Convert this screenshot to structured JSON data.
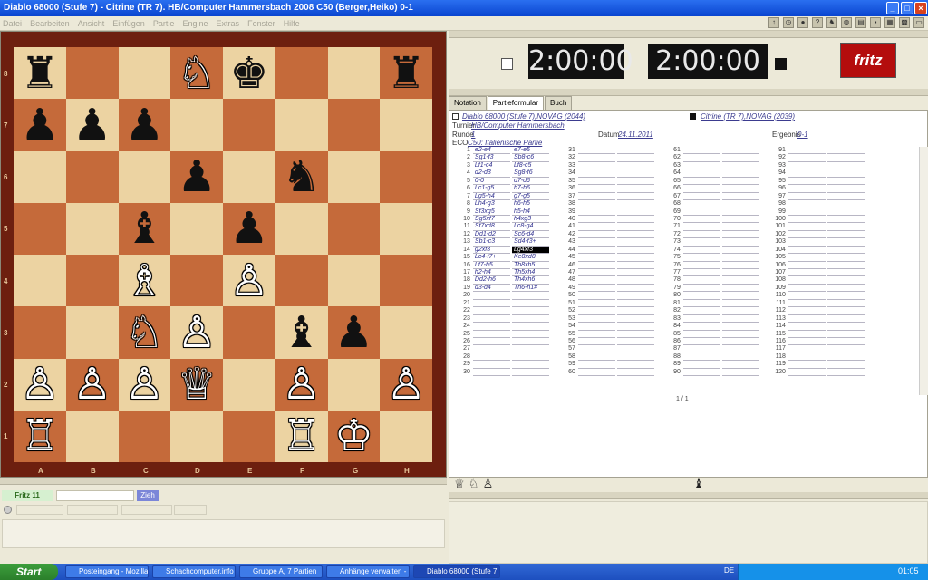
{
  "window": {
    "title": "Diablo 68000 (Stufe 7) - Citrine (TR 7). HB/Computer Hammersbach 2008  C50  (Berger,Heiko)  0-1"
  },
  "menu": [
    "Datei",
    "Bearbeiten",
    "Ansicht",
    "Einfügen",
    "Partie",
    "Engine",
    "Extras",
    "Fenster",
    "Hilfe"
  ],
  "board": {
    "files": [
      "A",
      "B",
      "C",
      "D",
      "E",
      "F",
      "G",
      "H"
    ],
    "ranks": [
      "8",
      "7",
      "6",
      "5",
      "4",
      "3",
      "2",
      "1"
    ],
    "position": [
      [
        "bR",
        "",
        "",
        "wN",
        "bK",
        "",
        "",
        "bR"
      ],
      [
        "bP",
        "bP",
        "bP",
        "",
        "",
        "",
        "",
        ""
      ],
      [
        "",
        "",
        "",
        "bP",
        "",
        "bN",
        "",
        ""
      ],
      [
        "",
        "",
        "bB",
        "",
        "bP",
        "",
        "",
        ""
      ],
      [
        "",
        "",
        "wB",
        "",
        "wP",
        "",
        "",
        ""
      ],
      [
        "",
        "",
        "wN",
        "wP",
        "",
        "bB",
        "bP",
        ""
      ],
      [
        "wP",
        "wP",
        "wP",
        "wQ",
        "",
        "wP",
        "",
        "wP"
      ],
      [
        "wR",
        "",
        "",
        "",
        "",
        "wR",
        "wK",
        ""
      ]
    ],
    "glyphs": {
      "wK": "♔",
      "wQ": "♕",
      "wR": "♖",
      "wB": "♗",
      "wN": "♘",
      "wP": "♙",
      "bK": "♚",
      "bQ": "♛",
      "bR": "♜",
      "bB": "♝",
      "bN": "♞",
      "bP": "♟"
    }
  },
  "clocks": {
    "white": "2:00:00",
    "black": "2:00:00"
  },
  "logo": "fritz",
  "tabs": [
    "Notation",
    "Partieformular",
    "Buch"
  ],
  "game": {
    "white": "Diablo 68000 (Stufe 7),NOVAG (2044)",
    "black": "Citrine (TR 7),NOVAG (2039)",
    "turnier_label": "Turnier",
    "turnier": "HB/Computer Hammersbach",
    "runde_label": "Runde",
    "runde": "1",
    "datum_label": "Datum",
    "datum": "24.11.2011",
    "ergebnis_label": "Ergebnis",
    "ergebnis": "0-1",
    "eco_label": "ECO",
    "eco": "C50: Italienische Partie"
  },
  "moves": [
    [
      "e2-e4",
      "e7-e5"
    ],
    [
      "Sg1-f3",
      "Sb8-c6"
    ],
    [
      "Lf1-c4",
      "Lf8-c5"
    ],
    [
      "d2-d3",
      "Sg8-f6"
    ],
    [
      "0-0",
      "d7-d6"
    ],
    [
      "Lc1-g5",
      "h7-h6"
    ],
    [
      "Lg5-h4",
      "g7-g5"
    ],
    [
      "Lh4-g3",
      "h6-h5"
    ],
    [
      "Sf3xg5",
      "h5-h4"
    ],
    [
      "Sg5xf7",
      "h4xg3"
    ],
    [
      "Sf7xd8",
      "Lc8-g4"
    ],
    [
      "Dd1-d2",
      "Sc6-d4"
    ],
    [
      "Sb1-c3",
      "Sd4-f3+"
    ],
    [
      "g2xf3",
      "Lg4xf3"
    ],
    [
      "Lc4-f7+",
      "Ke8xd8"
    ],
    [
      "Lf7-h5",
      "Th8xh5"
    ],
    [
      "h2-h4",
      "Th5xh4"
    ],
    [
      "Dd2-h6",
      "Th4xh6"
    ],
    [
      "d3-d4",
      "Th6-h1#"
    ]
  ],
  "page_indicator": "1 / 1",
  "engine": {
    "name": "Fritz 11",
    "button": "Zieh"
  },
  "taskbar": {
    "start": "Start",
    "tasks": [
      "Posteingang - Mozilla ...",
      "Schachcomputer.info ...",
      "Gruppe A, 7 Partien",
      "Anhänge verwalten - ...",
      "Diablo 68000 (Stufe 7..."
    ],
    "lang": "DE",
    "time": "01:05"
  }
}
